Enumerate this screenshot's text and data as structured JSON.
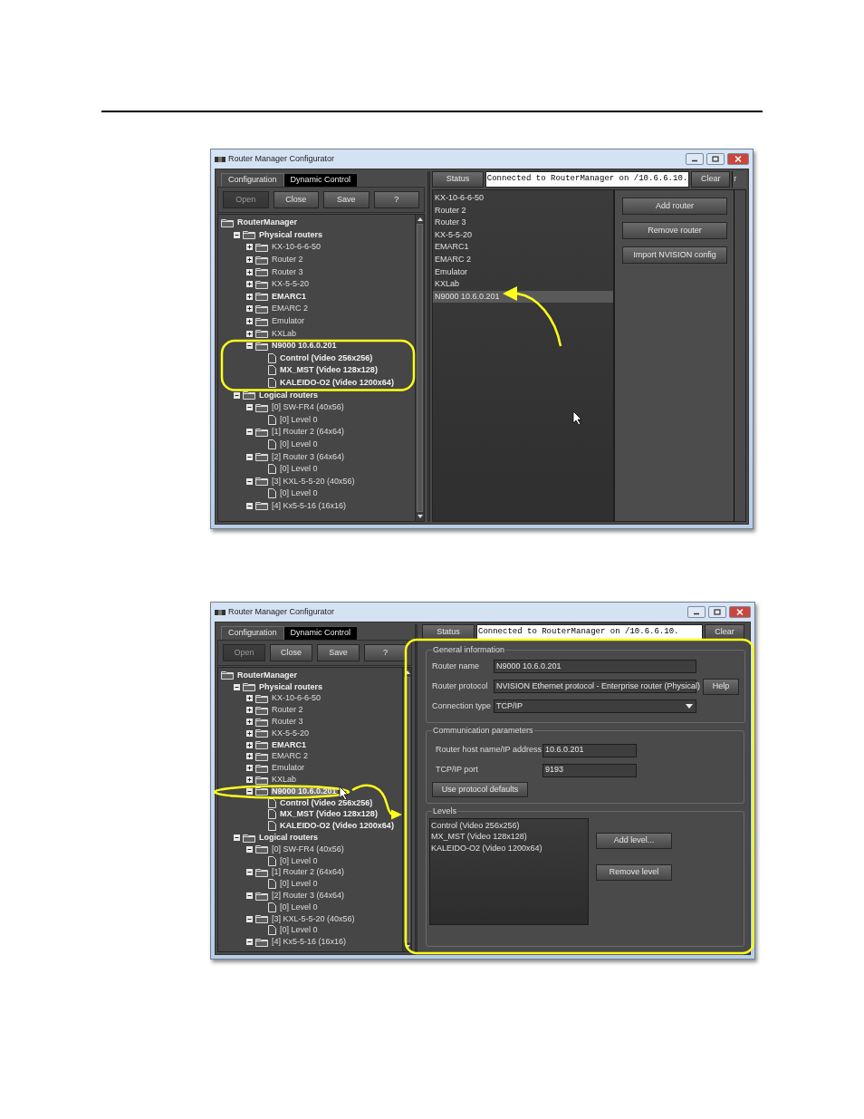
{
  "screenshots": [
    {
      "kind": "router_list",
      "window": {
        "title": "Router Manager Configurator"
      },
      "tabs": [
        {
          "label": "Configuration",
          "selected": true
        },
        {
          "label": "Dynamic Control",
          "selected": false
        }
      ],
      "toolbar": [
        {
          "label": "Open",
          "disabled": true
        },
        {
          "label": "Close",
          "disabled": false
        },
        {
          "label": "Save",
          "disabled": false
        },
        {
          "label": "?",
          "disabled": false
        }
      ],
      "tree": [
        {
          "label": "RouterManager",
          "kind": "folder",
          "bold": true,
          "selected": false,
          "children": [
            {
              "label": "Physical routers",
              "kind": "folder",
              "bold": true,
              "expanded": true,
              "selected": false,
              "children": [
                {
                  "label": "KX-10-6-6-50",
                  "kind": "folder",
                  "bold": false,
                  "expanded": false,
                  "selected": false
                },
                {
                  "label": "Router 2",
                  "kind": "folder",
                  "bold": false,
                  "expanded": false,
                  "selected": false
                },
                {
                  "label": "Router 3",
                  "kind": "folder",
                  "bold": false,
                  "expanded": false,
                  "selected": false
                },
                {
                  "label": "KX-5-5-20",
                  "kind": "folder",
                  "bold": false,
                  "expanded": false,
                  "selected": false
                },
                {
                  "label": "EMARC1",
                  "kind": "folder",
                  "bold": true,
                  "expanded": false,
                  "selected": false
                },
                {
                  "label": "EMARC 2",
                  "kind": "folder",
                  "bold": false,
                  "expanded": false,
                  "selected": false
                },
                {
                  "label": "Emulator",
                  "kind": "folder",
                  "bold": false,
                  "expanded": false,
                  "selected": false
                },
                {
                  "label": "KXLab",
                  "kind": "folder",
                  "bold": false,
                  "expanded": false,
                  "selected": false
                },
                {
                  "label": "N9000 10.6.0.201",
                  "kind": "folder",
                  "bold": true,
                  "expanded": true,
                  "selected": false,
                  "children": [
                    {
                      "label": "Control (Video 256x256)",
                      "kind": "leaf",
                      "bold": true,
                      "selected": false
                    },
                    {
                      "label": "MX_MST (Video 128x128)",
                      "kind": "leaf",
                      "bold": true,
                      "selected": false
                    },
                    {
                      "label": "KALEIDO-O2 (Video 1200x64)",
                      "kind": "leaf",
                      "bold": true,
                      "selected": false
                    }
                  ]
                }
              ]
            },
            {
              "label": "Logical routers",
              "kind": "folder",
              "bold": true,
              "expanded": true,
              "selected": false,
              "children": [
                {
                  "label": "[0] SW-FR4 (40x56)",
                  "kind": "folder",
                  "bold": false,
                  "expanded": true,
                  "selected": false,
                  "children": [
                    {
                      "label": "[0] Level 0",
                      "kind": "leaf",
                      "bold": false,
                      "selected": false
                    }
                  ]
                },
                {
                  "label": "[1] Router 2 (64x64)",
                  "kind": "folder",
                  "bold": false,
                  "expanded": true,
                  "selected": false,
                  "children": [
                    {
                      "label": "[0] Level 0",
                      "kind": "leaf",
                      "bold": false,
                      "selected": false
                    }
                  ]
                },
                {
                  "label": "[2] Router 3 (64x64)",
                  "kind": "folder",
                  "bold": false,
                  "expanded": true,
                  "selected": false,
                  "children": [
                    {
                      "label": "[0] Level 0",
                      "kind": "leaf",
                      "bold": false,
                      "selected": false
                    }
                  ]
                },
                {
                  "label": "[3] KXL-5-5-20 (40x56)",
                  "kind": "folder",
                  "bold": false,
                  "expanded": true,
                  "selected": false,
                  "children": [
                    {
                      "label": "[0] Level 0",
                      "kind": "leaf",
                      "bold": false,
                      "selected": false
                    }
                  ]
                },
                {
                  "label": "[4] Kx5-5-16 (16x16)",
                  "kind": "folder",
                  "bold": false,
                  "expanded": true,
                  "selected": false
                }
              ]
            }
          ]
        }
      ],
      "status": {
        "button": "Status",
        "message": "Connected to RouterManager on /10.6.6.10.",
        "clear": "Clear",
        "clipped_text": "r"
      },
      "routers": [
        {
          "label": "KX-10-6-6-50",
          "selected": false
        },
        {
          "label": "Router 2",
          "selected": false
        },
        {
          "label": "Router 3",
          "selected": false
        },
        {
          "label": "KX-5-5-20",
          "selected": false
        },
        {
          "label": "EMARC1",
          "selected": false
        },
        {
          "label": "EMARC 2",
          "selected": false
        },
        {
          "label": "Emulator",
          "selected": false
        },
        {
          "label": "KXLab",
          "selected": false
        },
        {
          "label": "N9000 10.6.0.201",
          "selected": true
        }
      ],
      "actions": [
        "Add router",
        "Remove router",
        "Import NVISION config"
      ]
    },
    {
      "kind": "router_details",
      "window": {
        "title": "Router Manager Configurator"
      },
      "tabs": [
        {
          "label": "Configuration",
          "selected": true
        },
        {
          "label": "Dynamic Control",
          "selected": false
        }
      ],
      "toolbar": [
        {
          "label": "Open",
          "disabled": true
        },
        {
          "label": "Close",
          "disabled": false
        },
        {
          "label": "Save",
          "disabled": false
        },
        {
          "label": "?",
          "disabled": false
        }
      ],
      "tree": [
        {
          "label": "RouterManager",
          "kind": "folder",
          "bold": true,
          "selected": false,
          "children": [
            {
              "label": "Physical routers",
              "kind": "folder",
              "bold": true,
              "expanded": true,
              "selected": false,
              "children": [
                {
                  "label": "KX-10-6-6-50",
                  "kind": "folder",
                  "bold": false,
                  "expanded": false,
                  "selected": false
                },
                {
                  "label": "Router 2",
                  "kind": "folder",
                  "bold": false,
                  "expanded": false,
                  "selected": false
                },
                {
                  "label": "Router 3",
                  "kind": "folder",
                  "bold": false,
                  "expanded": false,
                  "selected": false
                },
                {
                  "label": "KX-5-5-20",
                  "kind": "folder",
                  "bold": false,
                  "expanded": false,
                  "selected": false
                },
                {
                  "label": "EMARC1",
                  "kind": "folder",
                  "bold": true,
                  "expanded": false,
                  "selected": false
                },
                {
                  "label": "EMARC 2",
                  "kind": "folder",
                  "bold": false,
                  "expanded": false,
                  "selected": false
                },
                {
                  "label": "Emulator",
                  "kind": "folder",
                  "bold": false,
                  "expanded": false,
                  "selected": false
                },
                {
                  "label": "KXLab",
                  "kind": "folder",
                  "bold": false,
                  "expanded": false,
                  "selected": false
                },
                {
                  "label": "N9000 10.6.0.201",
                  "kind": "folder",
                  "bold": true,
                  "expanded": true,
                  "selected": true,
                  "children": [
                    {
                      "label": "Control (Video 256x256)",
                      "kind": "leaf",
                      "bold": true,
                      "selected": false
                    },
                    {
                      "label": "MX_MST (Video 128x128)",
                      "kind": "leaf",
                      "bold": true,
                      "selected": false
                    },
                    {
                      "label": "KALEIDO-O2 (Video 1200x64)",
                      "kind": "leaf",
                      "bold": true,
                      "selected": false
                    }
                  ]
                }
              ]
            },
            {
              "label": "Logical routers",
              "kind": "folder",
              "bold": true,
              "expanded": true,
              "selected": false,
              "children": [
                {
                  "label": "[0] SW-FR4 (40x56)",
                  "kind": "folder",
                  "bold": false,
                  "expanded": true,
                  "selected": false,
                  "children": [
                    {
                      "label": "[0] Level 0",
                      "kind": "leaf",
                      "bold": false,
                      "selected": false
                    }
                  ]
                },
                {
                  "label": "[1] Router 2 (64x64)",
                  "kind": "folder",
                  "bold": false,
                  "expanded": true,
                  "selected": false,
                  "children": [
                    {
                      "label": "[0] Level 0",
                      "kind": "leaf",
                      "bold": false,
                      "selected": false
                    }
                  ]
                },
                {
                  "label": "[2] Router 3 (64x64)",
                  "kind": "folder",
                  "bold": false,
                  "expanded": true,
                  "selected": false,
                  "children": [
                    {
                      "label": "[0] Level 0",
                      "kind": "leaf",
                      "bold": false,
                      "selected": false
                    }
                  ]
                },
                {
                  "label": "[3] KXL-5-5-20 (40x56)",
                  "kind": "folder",
                  "bold": false,
                  "expanded": true,
                  "selected": false,
                  "children": [
                    {
                      "label": "[0] Level 0",
                      "kind": "leaf",
                      "bold": false,
                      "selected": false
                    }
                  ]
                },
                {
                  "label": "[4] Kx5-5-16 (16x16)",
                  "kind": "folder",
                  "bold": false,
                  "expanded": true,
                  "selected": false
                }
              ]
            }
          ]
        }
      ],
      "status": {
        "button": "Status",
        "message": "Connected to RouterManager on /10.6.6.10.",
        "clear": "Clear"
      },
      "details": {
        "general": {
          "title": "General information",
          "fields": [
            {
              "label": "Router name",
              "kind": "text",
              "value": "N9000 10.6.0.201"
            },
            {
              "label": "Router protocol",
              "kind": "dropdown",
              "value": "NVISION Ethernet protocol - Enterprise router (Physical)",
              "button": "Help"
            },
            {
              "label": "Connection type",
              "kind": "dropdown",
              "value": "TCP/IP"
            }
          ]
        },
        "communication": {
          "title": "Communication parameters",
          "fields": [
            {
              "label": "Router host name/IP address",
              "kind": "text",
              "value": "10.6.0.201"
            },
            {
              "label": "TCP/IP port",
              "kind": "text",
              "value": "9193"
            }
          ],
          "button": "Use protocol defaults"
        },
        "levels": {
          "title": "Levels",
          "items": [
            "Control (Video 256x256)",
            "MX_MST (Video 128x128)",
            "KALEIDO-O2 (Video 1200x64)"
          ],
          "buttons": [
            "Add level...",
            "Remove level"
          ]
        }
      }
    }
  ]
}
